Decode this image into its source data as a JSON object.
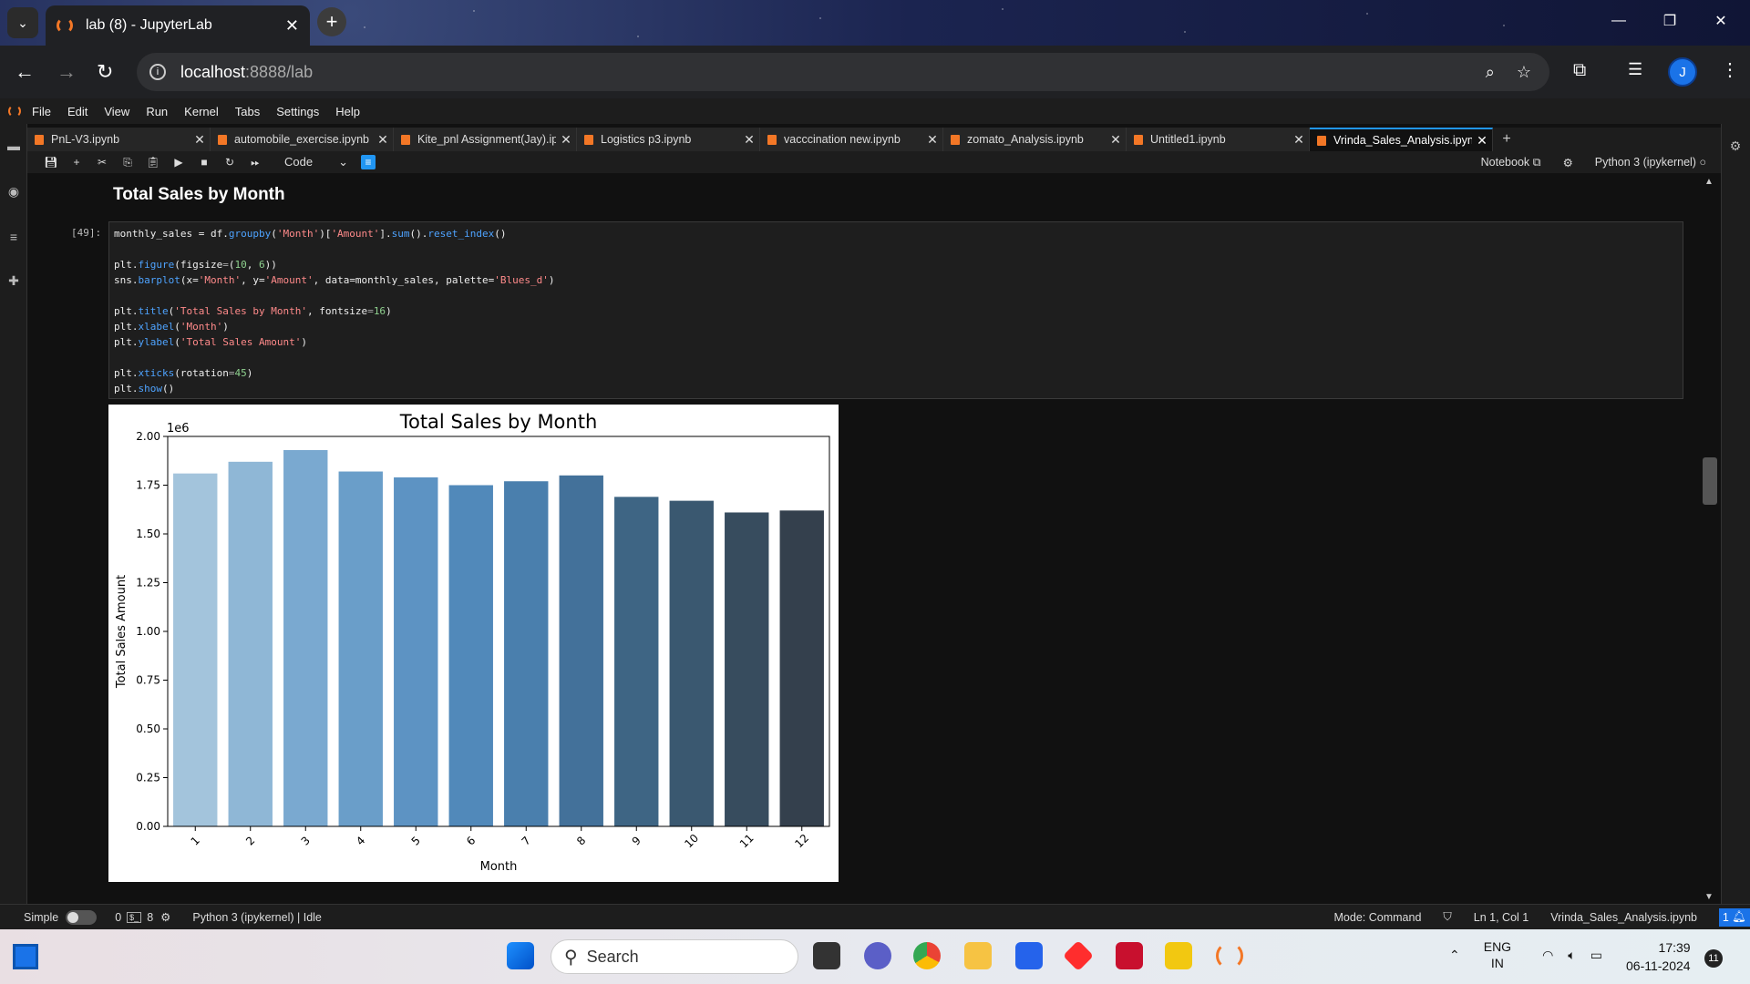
{
  "browser": {
    "tab_title": "lab (8) - JupyterLab",
    "url_host": "localhost",
    "url_path": ":8888/lab",
    "avatar_letter": "J"
  },
  "jupyter": {
    "menu": [
      "File",
      "Edit",
      "View",
      "Run",
      "Kernel",
      "Tabs",
      "Settings",
      "Help"
    ],
    "tabs": [
      {
        "label": "PnL-V3.ipynb",
        "active": false
      },
      {
        "label": "automobile_exercise.ipynb",
        "active": false
      },
      {
        "label": "Kite_pnl Assignment(Jay).ipyı",
        "active": false
      },
      {
        "label": "Logistics p3.ipynb",
        "active": false
      },
      {
        "label": "vacccination new.ipynb",
        "active": false
      },
      {
        "label": "zomato_Analysis.ipynb",
        "active": false
      },
      {
        "label": "Untitled1.ipynb",
        "active": false
      },
      {
        "label": "Vrinda_Sales_Analysis.ipynb",
        "active": true
      }
    ],
    "toolbar": {
      "cell_type": "Code",
      "notebook_label": "Notebook",
      "kernel_label": "Python 3 (ipykernel)"
    },
    "heading": "Total Sales by Month",
    "cell_prompt": "[49]:",
    "code_lines": [
      "monthly_sales = df.groupby('Month')['Amount'].sum().reset_index()",
      "",
      "plt.figure(figsize=(10, 6))",
      "sns.barplot(x='Month', y='Amount', data=monthly_sales, palette='Blues_d')",
      "",
      "plt.title('Total Sales by Month', fontsize=16)",
      "plt.xlabel('Month')",
      "plt.ylabel('Total Sales Amount')",
      "",
      "plt.xticks(rotation=45)",
      "plt.show()"
    ],
    "status": {
      "mode_label": "Simple",
      "terminals": "0",
      "kernels": "8",
      "kernel_status": "Python 3 (ipykernel) | Idle",
      "mode": "Mode: Command",
      "cursor": "Ln 1, Col 1",
      "filename": "Vrinda_Sales_Analysis.ipynb",
      "notifications": "1"
    }
  },
  "taskbar": {
    "search_placeholder": "Search",
    "lang_top": "ENG",
    "lang_bottom": "IN",
    "time": "17:39",
    "date": "06-11-2024",
    "badge": "11"
  },
  "chart_data": {
    "type": "bar",
    "title": "Total Sales by Month",
    "xlabel": "Month",
    "ylabel": "Total Sales Amount",
    "y_multiplier_label": "1e6",
    "categories": [
      "1",
      "2",
      "3",
      "4",
      "5",
      "6",
      "7",
      "8",
      "9",
      "10",
      "11",
      "12"
    ],
    "values": [
      1.81,
      1.87,
      1.93,
      1.82,
      1.79,
      1.75,
      1.77,
      1.8,
      1.69,
      1.67,
      1.61,
      1.62
    ],
    "ylim": [
      0,
      2.0
    ],
    "yticks": [
      "0.00",
      "0.25",
      "0.50",
      "0.75",
      "1.00",
      "1.25",
      "1.50",
      "1.75",
      "2.00"
    ],
    "colors": [
      "#a3c4dc",
      "#8fb7d6",
      "#7aa9d0",
      "#6a9ec9",
      "#5d93c3",
      "#5189ba",
      "#4a7fad",
      "#43719a",
      "#3e6584",
      "#3a5870",
      "#374c5e",
      "#34404d"
    ],
    "grid": false,
    "legend": "none"
  }
}
